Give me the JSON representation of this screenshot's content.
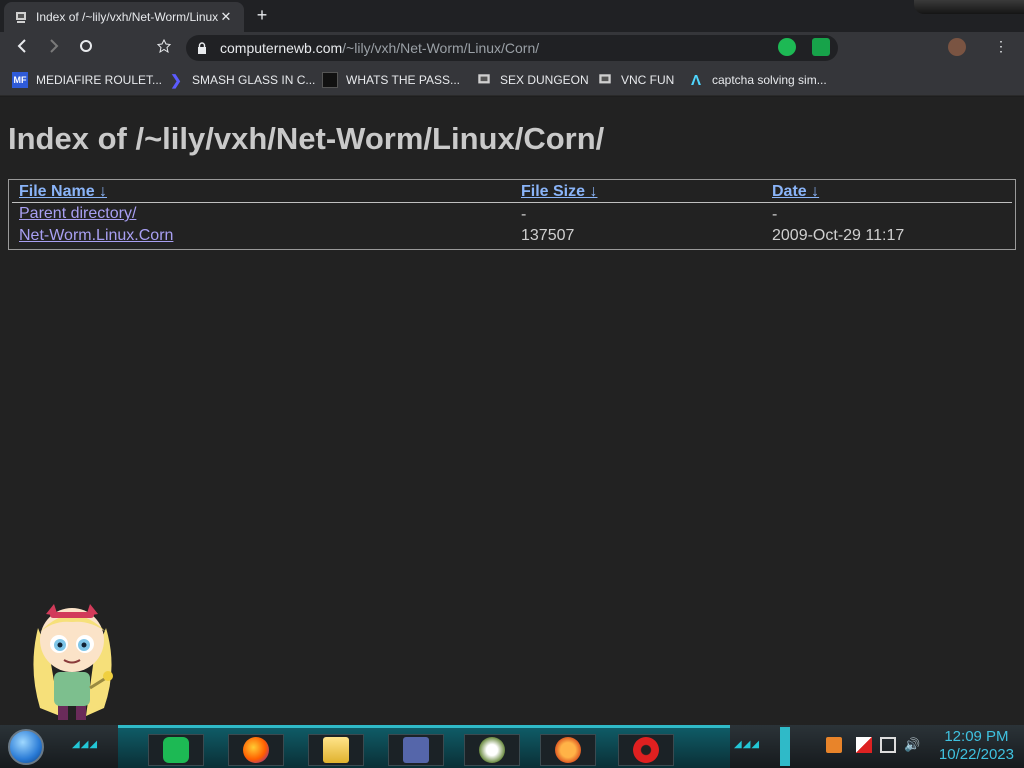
{
  "browser": {
    "tab": {
      "title": "Index of /~lily/vxh/Net-Worm/Linux/Corn/"
    },
    "omnibox": {
      "host": "computernewb.com",
      "path": "/~lily/vxh/Net-Worm/Linux/Corn/"
    },
    "bookmarks": [
      {
        "label": "MEDIAFIRE ROULET...",
        "icon": "mediafire-icon",
        "badge": "MF"
      },
      {
        "label": "SMASH GLASS IN C...",
        "icon": "chevron-bookmark-icon",
        "badge": ""
      },
      {
        "label": "WHATS THE PASS...",
        "icon": "dark-square-icon",
        "badge": ""
      },
      {
        "label": "SEX DUNGEON",
        "icon": "computernewb-icon",
        "badge": ""
      },
      {
        "label": "VNC FUN",
        "icon": "computernewb-icon",
        "badge": ""
      },
      {
        "label": "captcha solving sim...",
        "icon": "lambda-icon",
        "badge": ""
      }
    ]
  },
  "page": {
    "title": "Index of /~lily/vxh/Net-Worm/Linux/Corn/",
    "columns": {
      "name": "File Name  ↓",
      "size": "File Size  ↓",
      "date": "Date  ↓"
    },
    "rows": [
      {
        "name": "Parent directory/",
        "size": "-",
        "date": "-"
      },
      {
        "name": "Net-Worm.Linux.Corn",
        "size": "137507",
        "date": "2009-Oct-29 11:17"
      }
    ]
  },
  "taskbar": {
    "apps": [
      "spotify-icon",
      "firefox-icon",
      "file-explorer-icon",
      "app-window-icon",
      "flower-app-icon",
      "p-app-icon",
      "radiation-app-icon"
    ],
    "clock": {
      "time": "12:09 PM",
      "date": "10/22/2023"
    }
  },
  "colors": {
    "link": "#a89ff2",
    "header_link": "#8ab4f8",
    "clock": "#3fc2e0",
    "taskbar_accent": "#2fbac8"
  }
}
